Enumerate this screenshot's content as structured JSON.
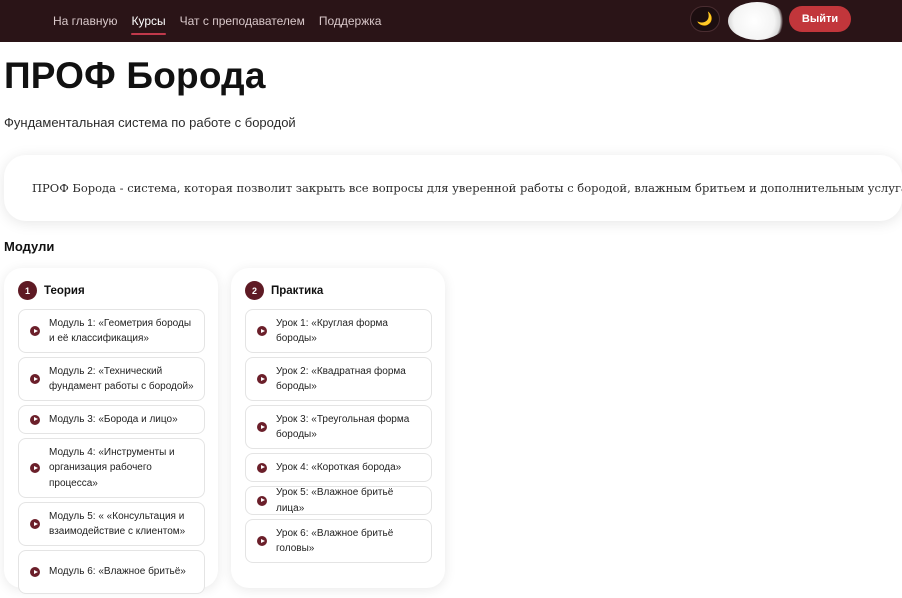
{
  "nav": {
    "items": [
      {
        "label": "На главную",
        "active": false
      },
      {
        "label": "Курсы",
        "active": true
      },
      {
        "label": "Чат с преподавателем",
        "active": false
      },
      {
        "label": "Поддержка",
        "active": false
      }
    ],
    "theme_icon": "moon-icon",
    "logout_label": "Выйти"
  },
  "course": {
    "title": "ПРОФ Борода",
    "subtitle": "Фундаментальная система по работе с бородой",
    "description": "ПРОФ Борода - система, которая позволит закрыть все вопросы для уверенной работы с бородой, влажным бритьем и дополнительным услугам."
  },
  "modules_section": {
    "title": "Модули",
    "columns": [
      {
        "number": "1",
        "title": "Теория",
        "items": [
          "Модуль 1: «Геометрия бороды и её классификация»",
          "Модуль 2: «Технический фундамент работы с бородой»",
          "Модуль 3: «Борода и лицо»",
          "Модуль 4: «Инструменты и организация рабочего процесса»",
          "Модуль 5: « «Консультация и взаимодействие с клиентом»",
          "Модуль 6: «Влажное бритьё»"
        ]
      },
      {
        "number": "2",
        "title": "Практика",
        "items": [
          "Урок 1: «Круглая форма бороды»",
          "Урок 2: «Квадратная форма бороды»",
          "Урок 3: «Треугольная форма бороды»",
          "Урок 4: «Короткая борода»",
          "Урок 5: «Влажное бритьё лица»",
          "Урок 6: «Влажное бритьё головы»"
        ]
      }
    ]
  },
  "colors": {
    "header_bg": "#2a1417",
    "accent": "#c2363b",
    "badge": "#5e1a24"
  }
}
